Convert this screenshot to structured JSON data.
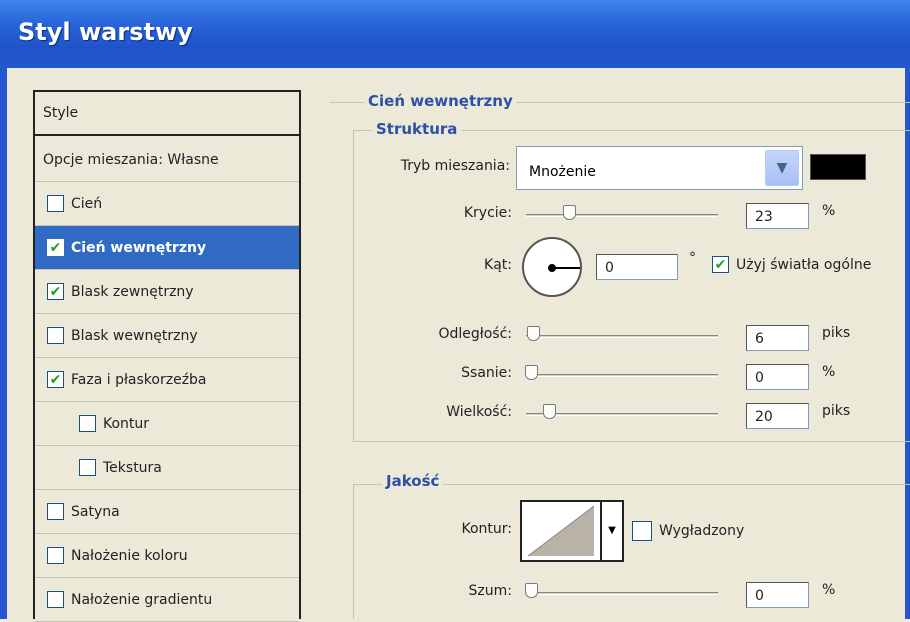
{
  "window": {
    "title": "Styl warstwy"
  },
  "style_list": {
    "header": "Style",
    "items": [
      {
        "label": "Opcje mieszania: Własne",
        "has_checkbox": false,
        "checked": false,
        "selected": false,
        "indent": false
      },
      {
        "label": "Cień",
        "has_checkbox": true,
        "checked": false,
        "selected": false,
        "indent": false
      },
      {
        "label": "Cień wewnętrzny",
        "has_checkbox": true,
        "checked": true,
        "selected": true,
        "indent": false
      },
      {
        "label": "Blask zewnętrzny",
        "has_checkbox": true,
        "checked": true,
        "selected": false,
        "indent": false
      },
      {
        "label": "Blask wewnętrzny",
        "has_checkbox": true,
        "checked": false,
        "selected": false,
        "indent": false
      },
      {
        "label": "Faza i płaskorzeźba",
        "has_checkbox": true,
        "checked": true,
        "selected": false,
        "indent": false
      },
      {
        "label": "Kontur",
        "has_checkbox": true,
        "checked": false,
        "selected": false,
        "indent": true
      },
      {
        "label": "Tekstura",
        "has_checkbox": true,
        "checked": false,
        "selected": false,
        "indent": true
      },
      {
        "label": "Satyna",
        "has_checkbox": true,
        "checked": false,
        "selected": false,
        "indent": false
      },
      {
        "label": "Nałożenie koloru",
        "has_checkbox": true,
        "checked": false,
        "selected": false,
        "indent": false
      },
      {
        "label": "Nałożenie gradientu",
        "has_checkbox": true,
        "checked": false,
        "selected": false,
        "indent": false
      }
    ]
  },
  "panel": {
    "title": "Cień wewnętrzny",
    "structure": {
      "title": "Struktura",
      "blend_mode_label": "Tryb mieszania:",
      "blend_mode_value": "Mnożenie",
      "blend_color": "#000000",
      "opacity_label": "Krycie:",
      "opacity_value": "23",
      "opacity_unit": "%",
      "angle_label": "Kąt:",
      "angle_value": "0",
      "angle_unit": "°",
      "global_light_label": "Użyj światła ogólne",
      "global_light_checked": true,
      "distance_label": "Odległość:",
      "distance_value": "6",
      "distance_unit": "piks",
      "choke_label": "Ssanie:",
      "choke_value": "0",
      "choke_unit": "%",
      "size_label": "Wielkość:",
      "size_value": "20",
      "size_unit": "piks"
    },
    "quality": {
      "title": "Jakość",
      "contour_label": "Kontur:",
      "antialias_label": "Wygładzony",
      "antialias_checked": false,
      "noise_label": "Szum:",
      "noise_value": "0",
      "noise_unit": "%"
    }
  },
  "icons": {
    "checkbox_mark": "✔",
    "dropdown_arrow": "▼",
    "contour_arrow": "▼"
  }
}
